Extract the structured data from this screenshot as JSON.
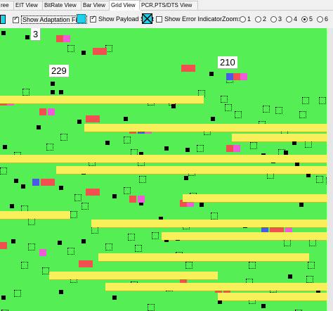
{
  "tabs": [
    {
      "label": "ree",
      "active": false
    },
    {
      "label": "EIT View",
      "active": false
    },
    {
      "label": "BitRate View",
      "active": false
    },
    {
      "label": "Bar View",
      "active": false
    },
    {
      "label": "Grid View",
      "active": true
    },
    {
      "label": "PCR,PTS/DTS View",
      "active": false
    }
  ],
  "toolbar": {
    "show_adaptation_field": "Show Adaptation Field",
    "show_payload_start": "Show Payload Start",
    "show_error_indicator": "Show Error Indicator",
    "zoom_label": "Zoom:",
    "zoom_options": [
      "1",
      "2",
      "3",
      "4",
      "5",
      "6"
    ],
    "zoom_selected": "5"
  },
  "grid": {
    "labels": [
      "3",
      "229",
      "210"
    ],
    "colors": {
      "background": "#55ee55",
      "yellow": "#f8f05a",
      "red": "#f25050",
      "magenta": "#f05ad8",
      "blue": "#4a5ae8"
    }
  }
}
